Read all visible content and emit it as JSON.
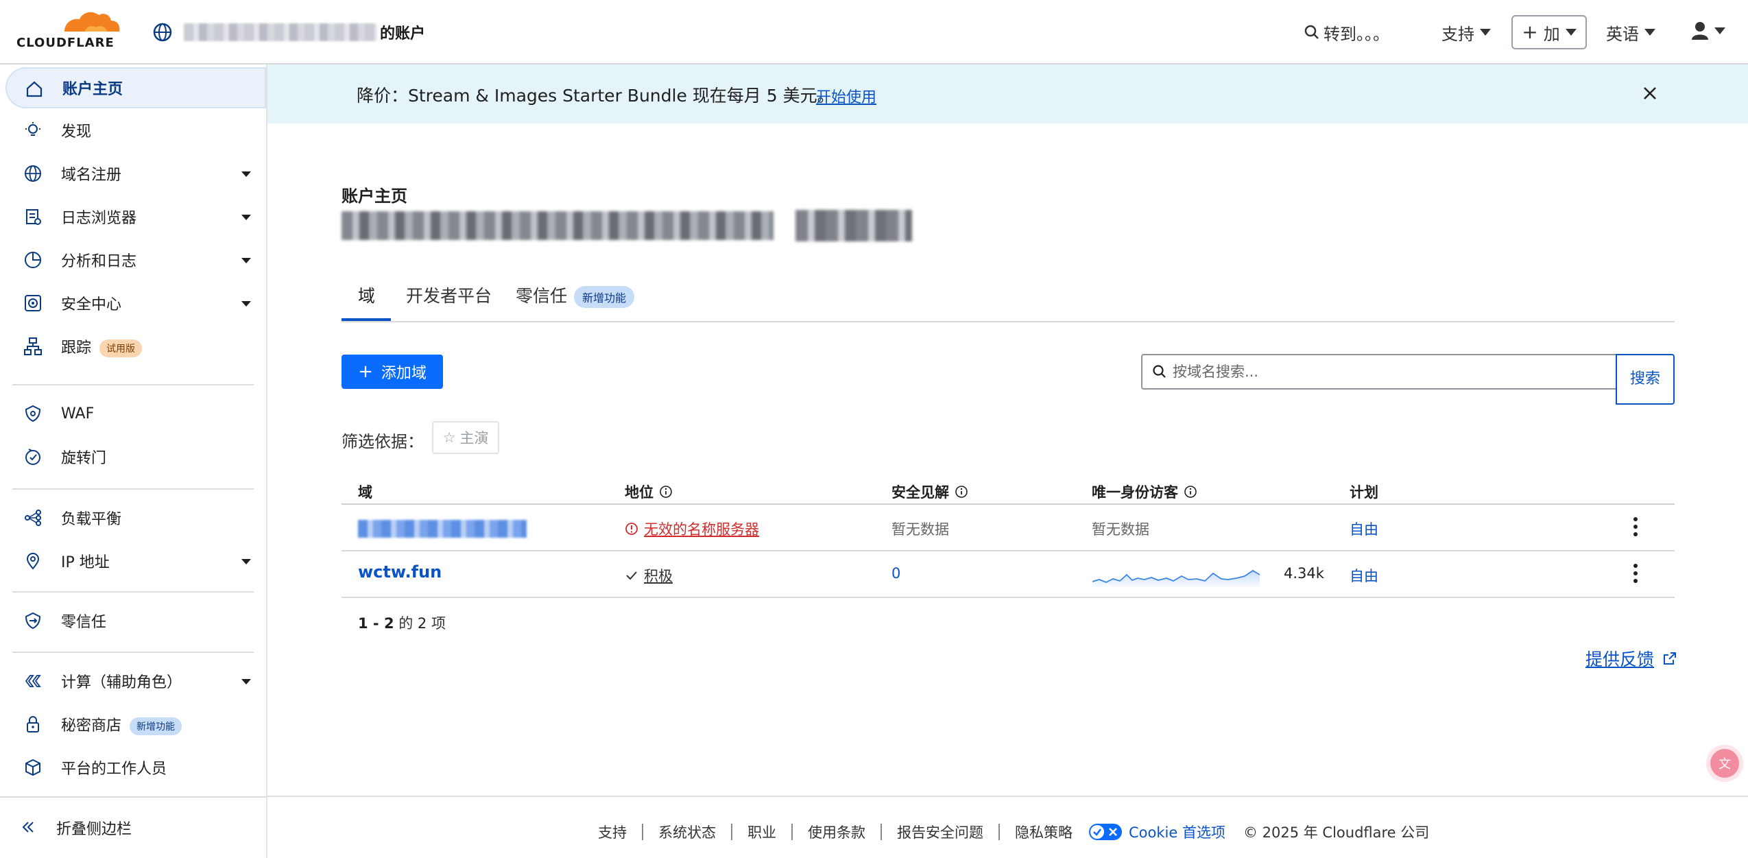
{
  "brand": {
    "logo_text": "CLOUDFLARE",
    "accent": "#f48120"
  },
  "header": {
    "account_suffix": "的账户",
    "goto": "转到。。。",
    "support": "支持",
    "add": "加",
    "language": "英语"
  },
  "sidebar": {
    "items": [
      {
        "label": "账户主页",
        "icon": "home-icon"
      },
      {
        "label": "发现",
        "icon": "lightbulb-icon"
      },
      {
        "label": "域名注册",
        "icon": "globe-icon"
      },
      {
        "label": "日志浏览器",
        "icon": "log-icon"
      },
      {
        "label": "分析和日志",
        "icon": "pie-chart-icon"
      },
      {
        "label": "安全中心",
        "icon": "radar-icon"
      },
      {
        "label": "跟踪",
        "icon": "sitemap-icon",
        "badge": "试用版"
      },
      {
        "label": "WAF",
        "icon": "shield-icon"
      },
      {
        "label": "旋转门",
        "icon": "turnstile-icon"
      },
      {
        "label": "负载平衡",
        "icon": "load-balance-icon"
      },
      {
        "label": "IP 地址",
        "icon": "location-pin-icon"
      },
      {
        "label": "零信任",
        "icon": "zero-trust-icon"
      },
      {
        "label": "计算（辅助角色）",
        "icon": "compute-icon"
      },
      {
        "label": "秘密商店",
        "icon": "lock-icon",
        "badge": "新增功能"
      },
      {
        "label": "平台的工作人员",
        "icon": "box-icon"
      }
    ],
    "collapse_label": "折叠侧边栏"
  },
  "banner": {
    "text": "降价：Stream & Images Starter Bundle 现在每月 5 美元。",
    "link": "开始使用"
  },
  "main": {
    "kicker": "账户主页",
    "tabs": [
      {
        "label": "域"
      },
      {
        "label": "开发者平台"
      },
      {
        "label": "零信任",
        "badge": "新增功能"
      }
    ],
    "add_domain": "添加域",
    "search": {
      "placeholder": "按域名搜索...",
      "button": "搜索"
    },
    "filter": {
      "label": "筛选依据：",
      "chip": "主演"
    },
    "table": {
      "headers": [
        "域",
        "地位",
        "安全见解",
        "唯一身份访客",
        "计划"
      ],
      "rows": [
        {
          "domain": "",
          "status": "无效的名称服务器",
          "insights": "暂无数据",
          "visitors": "暂无数据",
          "plan": "自由"
        },
        {
          "domain": "wctw.fun",
          "status": "积极",
          "insights": "0",
          "visitors": "4.34k",
          "plan": "自由"
        }
      ]
    },
    "pager": {
      "range": "1 - 2",
      "middle": " 的 ",
      "total": "2",
      "suffix": " 项"
    },
    "feedback": "提供反馈"
  },
  "footer": {
    "links": [
      "支持",
      "系统状态",
      "职业",
      "使用条款",
      "报告安全问题",
      "隐私策略"
    ],
    "cookie": "Cookie 首选项",
    "copyright": "© 2025 年 Cloudflare 公司"
  }
}
